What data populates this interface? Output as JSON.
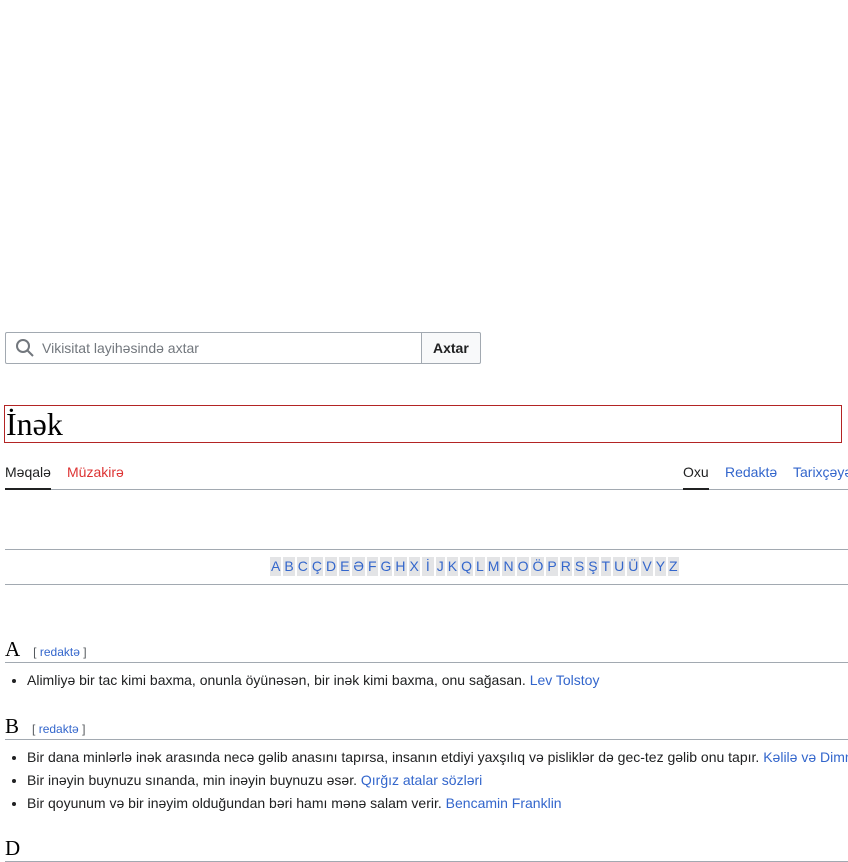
{
  "search": {
    "placeholder": "Vikisitat layihəsində axtar",
    "button": "Axtar"
  },
  "page_title": "İnək",
  "tabs_left": [
    "Məqalə",
    "Müzakirə"
  ],
  "tabs_right": [
    "Oxu",
    "Redaktə",
    "Tarixçəyə"
  ],
  "toc": [
    "A",
    "B",
    "C",
    "Ç",
    "D",
    "E",
    "Ə",
    "F",
    "G",
    "H",
    "X",
    "İ",
    "J",
    "K",
    "Q",
    "L",
    "M",
    "N",
    "O",
    "Ö",
    "P",
    "R",
    "S",
    "Ş",
    "T",
    "U",
    "Ü",
    "V",
    "Y",
    "Z"
  ],
  "sections": [
    {
      "heading": "A",
      "edit_open": "[",
      "edit": "redaktə",
      "edit_close": "]",
      "items": [
        {
          "text": "Alimliyə bir tac kimi baxma, onunla öyünəsən, bir inək kimi baxma, onu sağasan.",
          "source": "Lev Tolstoy"
        }
      ]
    },
    {
      "heading": "B",
      "edit_open": "[",
      "edit": "redaktə",
      "edit_close": "]",
      "items": [
        {
          "text": "Bir dana minlərlə inək arasında necə gəlib anasını tapırsa, insanın etdiyi yaxşılıq və pisliklər də gec-tez gəlib onu tapır.",
          "source": "Kəlilə və Dimnə"
        },
        {
          "text": "Bir inəyin buynuzu sınanda, min inəyin buynuzu əsər.",
          "source": "Qırğız atalar sözləri"
        },
        {
          "text": "Bir qoyunum və bir inəyim olduğundan bəri hamı mənə salam verir.",
          "source": "Bencamin Franklin"
        }
      ]
    },
    {
      "heading": "D"
    }
  ]
}
